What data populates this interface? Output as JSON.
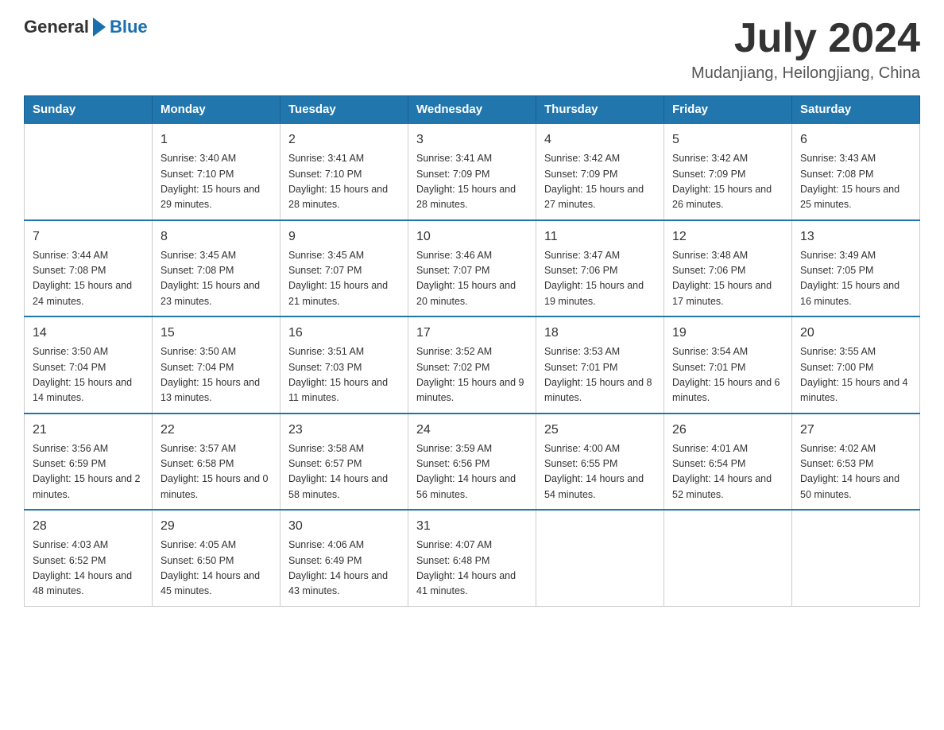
{
  "header": {
    "logo": {
      "general": "General",
      "arrow_icon": "▶",
      "blue": "Blue"
    },
    "title": "July 2024",
    "location": "Mudanjiang, Heilongjiang, China"
  },
  "days_of_week": [
    "Sunday",
    "Monday",
    "Tuesday",
    "Wednesday",
    "Thursday",
    "Friday",
    "Saturday"
  ],
  "weeks": [
    [
      {
        "day": "",
        "sunrise": "",
        "sunset": "",
        "daylight": ""
      },
      {
        "day": "1",
        "sunrise": "Sunrise: 3:40 AM",
        "sunset": "Sunset: 7:10 PM",
        "daylight": "Daylight: 15 hours and 29 minutes."
      },
      {
        "day": "2",
        "sunrise": "Sunrise: 3:41 AM",
        "sunset": "Sunset: 7:10 PM",
        "daylight": "Daylight: 15 hours and 28 minutes."
      },
      {
        "day": "3",
        "sunrise": "Sunrise: 3:41 AM",
        "sunset": "Sunset: 7:09 PM",
        "daylight": "Daylight: 15 hours and 28 minutes."
      },
      {
        "day": "4",
        "sunrise": "Sunrise: 3:42 AM",
        "sunset": "Sunset: 7:09 PM",
        "daylight": "Daylight: 15 hours and 27 minutes."
      },
      {
        "day": "5",
        "sunrise": "Sunrise: 3:42 AM",
        "sunset": "Sunset: 7:09 PM",
        "daylight": "Daylight: 15 hours and 26 minutes."
      },
      {
        "day": "6",
        "sunrise": "Sunrise: 3:43 AM",
        "sunset": "Sunset: 7:08 PM",
        "daylight": "Daylight: 15 hours and 25 minutes."
      }
    ],
    [
      {
        "day": "7",
        "sunrise": "Sunrise: 3:44 AM",
        "sunset": "Sunset: 7:08 PM",
        "daylight": "Daylight: 15 hours and 24 minutes."
      },
      {
        "day": "8",
        "sunrise": "Sunrise: 3:45 AM",
        "sunset": "Sunset: 7:08 PM",
        "daylight": "Daylight: 15 hours and 23 minutes."
      },
      {
        "day": "9",
        "sunrise": "Sunrise: 3:45 AM",
        "sunset": "Sunset: 7:07 PM",
        "daylight": "Daylight: 15 hours and 21 minutes."
      },
      {
        "day": "10",
        "sunrise": "Sunrise: 3:46 AM",
        "sunset": "Sunset: 7:07 PM",
        "daylight": "Daylight: 15 hours and 20 minutes."
      },
      {
        "day": "11",
        "sunrise": "Sunrise: 3:47 AM",
        "sunset": "Sunset: 7:06 PM",
        "daylight": "Daylight: 15 hours and 19 minutes."
      },
      {
        "day": "12",
        "sunrise": "Sunrise: 3:48 AM",
        "sunset": "Sunset: 7:06 PM",
        "daylight": "Daylight: 15 hours and 17 minutes."
      },
      {
        "day": "13",
        "sunrise": "Sunrise: 3:49 AM",
        "sunset": "Sunset: 7:05 PM",
        "daylight": "Daylight: 15 hours and 16 minutes."
      }
    ],
    [
      {
        "day": "14",
        "sunrise": "Sunrise: 3:50 AM",
        "sunset": "Sunset: 7:04 PM",
        "daylight": "Daylight: 15 hours and 14 minutes."
      },
      {
        "day": "15",
        "sunrise": "Sunrise: 3:50 AM",
        "sunset": "Sunset: 7:04 PM",
        "daylight": "Daylight: 15 hours and 13 minutes."
      },
      {
        "day": "16",
        "sunrise": "Sunrise: 3:51 AM",
        "sunset": "Sunset: 7:03 PM",
        "daylight": "Daylight: 15 hours and 11 minutes."
      },
      {
        "day": "17",
        "sunrise": "Sunrise: 3:52 AM",
        "sunset": "Sunset: 7:02 PM",
        "daylight": "Daylight: 15 hours and 9 minutes."
      },
      {
        "day": "18",
        "sunrise": "Sunrise: 3:53 AM",
        "sunset": "Sunset: 7:01 PM",
        "daylight": "Daylight: 15 hours and 8 minutes."
      },
      {
        "day": "19",
        "sunrise": "Sunrise: 3:54 AM",
        "sunset": "Sunset: 7:01 PM",
        "daylight": "Daylight: 15 hours and 6 minutes."
      },
      {
        "day": "20",
        "sunrise": "Sunrise: 3:55 AM",
        "sunset": "Sunset: 7:00 PM",
        "daylight": "Daylight: 15 hours and 4 minutes."
      }
    ],
    [
      {
        "day": "21",
        "sunrise": "Sunrise: 3:56 AM",
        "sunset": "Sunset: 6:59 PM",
        "daylight": "Daylight: 15 hours and 2 minutes."
      },
      {
        "day": "22",
        "sunrise": "Sunrise: 3:57 AM",
        "sunset": "Sunset: 6:58 PM",
        "daylight": "Daylight: 15 hours and 0 minutes."
      },
      {
        "day": "23",
        "sunrise": "Sunrise: 3:58 AM",
        "sunset": "Sunset: 6:57 PM",
        "daylight": "Daylight: 14 hours and 58 minutes."
      },
      {
        "day": "24",
        "sunrise": "Sunrise: 3:59 AM",
        "sunset": "Sunset: 6:56 PM",
        "daylight": "Daylight: 14 hours and 56 minutes."
      },
      {
        "day": "25",
        "sunrise": "Sunrise: 4:00 AM",
        "sunset": "Sunset: 6:55 PM",
        "daylight": "Daylight: 14 hours and 54 minutes."
      },
      {
        "day": "26",
        "sunrise": "Sunrise: 4:01 AM",
        "sunset": "Sunset: 6:54 PM",
        "daylight": "Daylight: 14 hours and 52 minutes."
      },
      {
        "day": "27",
        "sunrise": "Sunrise: 4:02 AM",
        "sunset": "Sunset: 6:53 PM",
        "daylight": "Daylight: 14 hours and 50 minutes."
      }
    ],
    [
      {
        "day": "28",
        "sunrise": "Sunrise: 4:03 AM",
        "sunset": "Sunset: 6:52 PM",
        "daylight": "Daylight: 14 hours and 48 minutes."
      },
      {
        "day": "29",
        "sunrise": "Sunrise: 4:05 AM",
        "sunset": "Sunset: 6:50 PM",
        "daylight": "Daylight: 14 hours and 45 minutes."
      },
      {
        "day": "30",
        "sunrise": "Sunrise: 4:06 AM",
        "sunset": "Sunset: 6:49 PM",
        "daylight": "Daylight: 14 hours and 43 minutes."
      },
      {
        "day": "31",
        "sunrise": "Sunrise: 4:07 AM",
        "sunset": "Sunset: 6:48 PM",
        "daylight": "Daylight: 14 hours and 41 minutes."
      },
      {
        "day": "",
        "sunrise": "",
        "sunset": "",
        "daylight": ""
      },
      {
        "day": "",
        "sunrise": "",
        "sunset": "",
        "daylight": ""
      },
      {
        "day": "",
        "sunrise": "",
        "sunset": "",
        "daylight": ""
      }
    ]
  ]
}
